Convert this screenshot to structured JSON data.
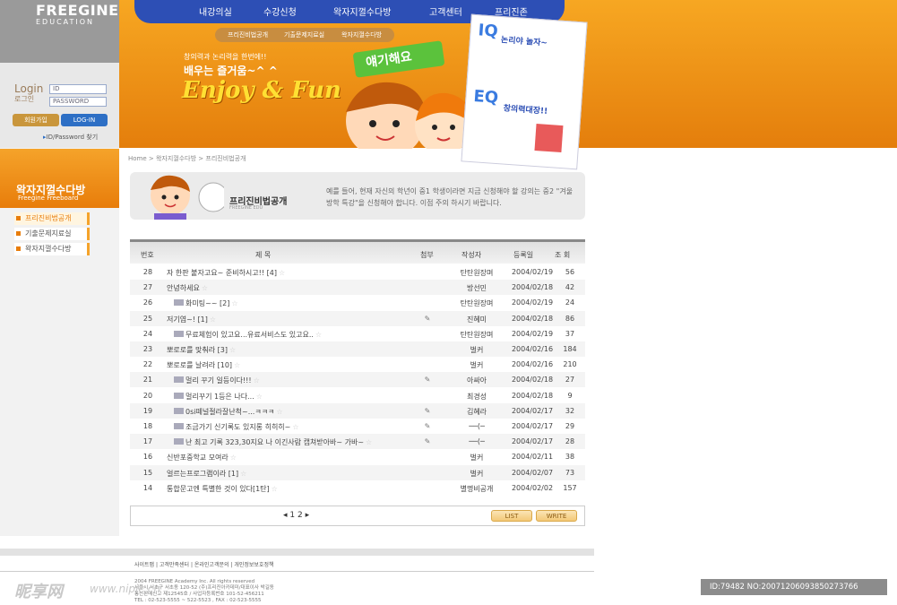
{
  "brand": {
    "name": "FREEGINE",
    "sub": "EDUCATION"
  },
  "login": {
    "label_en": "Login",
    "label_ko": "로그인",
    "id_placeholder": "ID",
    "pw_placeholder": "PASSWORD",
    "join_label": "회원가입",
    "login_label": "LOG-IN",
    "find_label": "ID/Password 찾기"
  },
  "nav": {
    "items": [
      "내강의실",
      "수강신청",
      "왁자지껄수다방",
      "고객센터",
      "프리진존"
    ],
    "sub_items": [
      "프리진비법공개",
      "기출문제지료실",
      "왁자지껄수다방"
    ]
  },
  "hero": {
    "line1": "창의력과 논리력을 한번에!!",
    "line2": "배우는 즐거움~^ ^",
    "line3": "Enjoy & Fun",
    "banner": "얘기해요"
  },
  "card": {
    "iq_title": "논리야 놀자~",
    "iq_tag": "IQ",
    "eq_title": "창의력대장!!",
    "eq_tag": "EQ"
  },
  "sidebar": {
    "title": "왁자지껄수다방",
    "subtitle": "Freegine Freeboard",
    "items": [
      "프리진비법공개",
      "기출문제지료실",
      "왁자지껄수다방"
    ]
  },
  "breadcrumb": "Home > 왁자지껄수다방 > 프리진비법공개",
  "intro": {
    "title": "프리진비법공개",
    "subtitle": "FREEGINE EDU",
    "text": "예를 들어, 현재 자신의 학년이 중1 학생이라면 지금 신청해야 할 강의는 중2 \"겨울방학 특강\"을 신청해야 합니다. 이점 주의 하시기 바랍니다."
  },
  "table": {
    "headers": [
      "번호",
      "제 목",
      "첨부",
      "작성자",
      "등록일",
      "조 회"
    ],
    "rows": [
      {
        "no": "28",
        "title": "자 한판 붙자고요~ 준비하시고!! [4]",
        "reply": false,
        "attach": "",
        "author": "탄탄원장며",
        "date": "2004/02/19",
        "hits": "56"
      },
      {
        "no": "27",
        "title": "안녕하세요",
        "reply": false,
        "attach": "",
        "author": "방선민",
        "date": "2004/02/18",
        "hits": "42"
      },
      {
        "no": "26",
        "title": "화미팅~~ [2]",
        "reply": true,
        "attach": "",
        "author": "탄탄원장며",
        "date": "2004/02/19",
        "hits": "24"
      },
      {
        "no": "25",
        "title": "저기염~! [1]",
        "reply": false,
        "attach": "✎",
        "author": "진혜미",
        "date": "2004/02/18",
        "hits": "86"
      },
      {
        "no": "24",
        "title": "무료체험이 있고요...유료서비스도 있고요..",
        "reply": true,
        "attach": "",
        "author": "탄탄원장며",
        "date": "2004/02/19",
        "hits": "37"
      },
      {
        "no": "23",
        "title": "뽀로로를 맞춰라 [3]",
        "reply": false,
        "attach": "",
        "author": "벌커",
        "date": "2004/02/16",
        "hits": "184"
      },
      {
        "no": "22",
        "title": "뽀로로를 날려라 [10]",
        "reply": false,
        "attach": "",
        "author": "벌커",
        "date": "2004/02/16",
        "hits": "210"
      },
      {
        "no": "21",
        "title": "멀리 꾸기 일등이다!!!",
        "reply": true,
        "attach": "✎",
        "author": "아싸아",
        "date": "2004/02/18",
        "hits": "27"
      },
      {
        "no": "20",
        "title": "멀리꾸기 1등은 나다...",
        "reply": true,
        "attach": "",
        "author": "최경성",
        "date": "2004/02/18",
        "hits": "9"
      },
      {
        "no": "19",
        "title": "0si떼널절라잘난척~...ㅋㅋㅋ",
        "reply": true,
        "attach": "✎",
        "author": "김혜라",
        "date": "2004/02/17",
        "hits": "32"
      },
      {
        "no": "18",
        "title": "조금가기 신기록도 있지롱 히히히~",
        "reply": true,
        "attach": "✎",
        "author": "──(─",
        "date": "2004/02/17",
        "hits": "29"
      },
      {
        "no": "17",
        "title": "난 최고 기록 323,30지요 나 이긴사람 캡쳐받아바~ 가바~",
        "reply": true,
        "attach": "✎",
        "author": "──(─",
        "date": "2004/02/17",
        "hits": "28"
      },
      {
        "no": "16",
        "title": "신반포중학교 모여라",
        "reply": false,
        "attach": "",
        "author": "벌커",
        "date": "2004/02/11",
        "hits": "38"
      },
      {
        "no": "15",
        "title": "얼르는프로그램이라 [1]",
        "reply": false,
        "attach": "",
        "author": "벌커",
        "date": "2004/02/07",
        "hits": "73"
      },
      {
        "no": "14",
        "title": "통합문고엔 특별한 것이 있다[1탄]",
        "reply": false,
        "attach": "",
        "author": "별명비공개",
        "date": "2004/02/02",
        "hits": "157"
      }
    ]
  },
  "pager": {
    "prev": "◂",
    "pages": "1 2",
    "next": "▸"
  },
  "buttons": {
    "list": "LIST",
    "write": "WRITE"
  },
  "footer": {
    "links": "사이트맵 | 고객만족센터 | 온라인고객문의 | 개인정보보호정책",
    "copyright": "2004 FREEGINE Academy Inc. All rights reserved",
    "address": "서울시 서초구 서초동 120-52 (주)프리진아카데미/대표이사 박길동",
    "biz": "통신판매신고 제12545호 / 사업자등록번호 101-52-456211",
    "tel": "TEL : 02-523-5555 ~ 522-5523 , FAX : 02-523-5555"
  },
  "watermark": {
    "logo": "昵享网",
    "url": "www.nipic.cn"
  },
  "image_id": "ID:79482 NO:20071206093850273766",
  "colors": {
    "orange": "#f0901a",
    "navy": "#2d4fb5",
    "grey": "#9a9a9a"
  }
}
